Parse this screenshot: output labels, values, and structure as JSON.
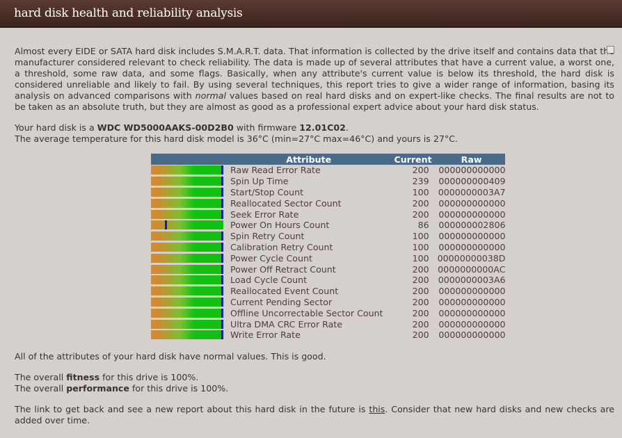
{
  "header": {
    "title": "hard disk health and reliability analysis"
  },
  "intro": {
    "p1": "Almost every EIDE or SATA hard disk includes S.M.A.R.T. data. That information is collected by the drive itself and contains data that the manufacturer considered relevant to check reliability. The data is made up of several attributes that have a current value, a worst one, a threshold, some raw data, and some flags. Basically, when any attribute's current value is below its threshold, the hard disk is considered unreliable and likely to fail. By using several techniques, this report tries to give a wider range of information, basing its analysis on advanced comparisons with ",
    "p1_em": "normal",
    "p1_tail": " values based on real hard disks and on expert-like checks. The final results are not to be taken as an absolute truth, but they are almost as good as a professional expert advice about your hard disk status."
  },
  "disk": {
    "model_prefix": "Your hard disk is a ",
    "model": "WDC WD5000AAKS-00D2B0",
    "firmware_prefix": " with firmware ",
    "firmware": "12.01C02",
    "firmware_suffix": ".",
    "temperature": "The average temperature for this hard disk model is 36°C (min=27°C max=46°C) and yours is 27°C."
  },
  "table": {
    "headers": {
      "attribute": "Attribute",
      "current": "Current",
      "raw": "Raw"
    },
    "rows": [
      {
        "attribute": "Raw Read Error Rate",
        "current": "200",
        "raw": "000000000000",
        "level": 1.0
      },
      {
        "attribute": "Spin Up Time",
        "current": "239",
        "raw": "000000000409",
        "level": 1.0
      },
      {
        "attribute": "Start/Stop Count",
        "current": "100",
        "raw": "0000000003A7",
        "level": 1.0
      },
      {
        "attribute": "Reallocated Sector Count",
        "current": "200",
        "raw": "000000000000",
        "level": 1.0
      },
      {
        "attribute": "Seek Error Rate",
        "current": "200",
        "raw": "000000000000",
        "level": 1.0
      },
      {
        "attribute": "Power On Hours Count",
        "current": "86",
        "raw": "000000002806",
        "level": 0.2
      },
      {
        "attribute": "Spin Retry Count",
        "current": "100",
        "raw": "000000000000",
        "level": 1.0
      },
      {
        "attribute": "Calibration Retry Count",
        "current": "100",
        "raw": "000000000000",
        "level": 1.0
      },
      {
        "attribute": "Power Cycle Count",
        "current": "100",
        "raw": "00000000038D",
        "level": 1.0
      },
      {
        "attribute": "Power Off Retract Count",
        "current": "200",
        "raw": "0000000000AC",
        "level": 1.0
      },
      {
        "attribute": "Load Cycle Count",
        "current": "200",
        "raw": "0000000003A6",
        "level": 1.0
      },
      {
        "attribute": "Reallocated Event Count",
        "current": "200",
        "raw": "000000000000",
        "level": 1.0
      },
      {
        "attribute": "Current Pending Sector",
        "current": "200",
        "raw": "000000000000",
        "level": 1.0
      },
      {
        "attribute": "Offline Uncorrectable Sector Count",
        "current": "200",
        "raw": "000000000000",
        "level": 1.0
      },
      {
        "attribute": "Ultra DMA CRC Error Rate",
        "current": "200",
        "raw": "000000000000",
        "level": 1.0
      },
      {
        "attribute": "Write Error Rate",
        "current": "200",
        "raw": "000000000000",
        "level": 1.0
      }
    ]
  },
  "summary": {
    "normal": "All of the attributes of your hard disk have normal values. This is good.",
    "fitness_pre": "The overall ",
    "fitness_word": "fitness",
    "fitness_post": " for this drive is 100%.",
    "performance_pre": "The overall ",
    "performance_word": "performance",
    "performance_post": " for this drive is 100%."
  },
  "link": {
    "pre": "The link to get back and see a new report about this hard disk in the future is ",
    "text": "this",
    "post": ". Consider that new hard disks and new checks are added over time."
  },
  "colors": {
    "header_bg": "#4a2e28",
    "table_header": "#4a6a8a",
    "bar_marker": "#1838d8"
  }
}
